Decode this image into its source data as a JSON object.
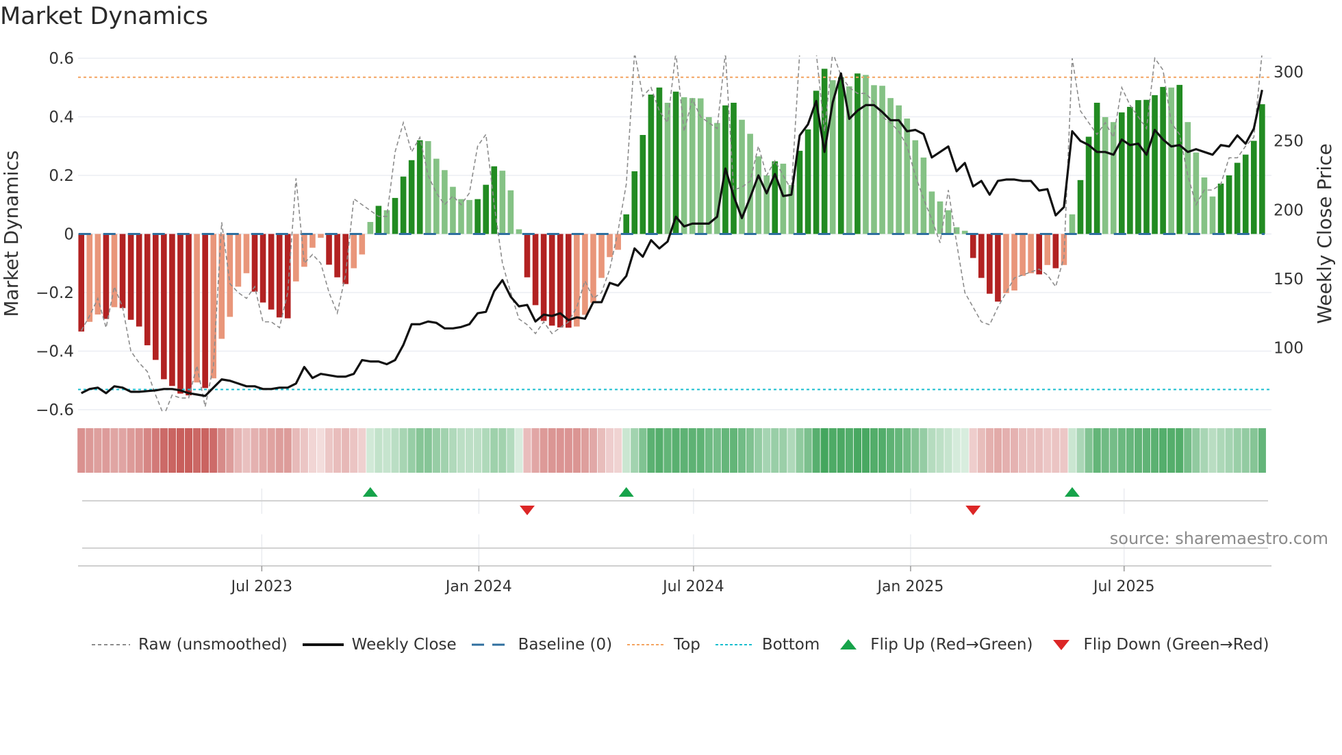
{
  "title": "Market Dynamics",
  "source": "source: sharemaestro.com",
  "legend": [
    {
      "key": "raw",
      "label": "Raw (unsmoothed)"
    },
    {
      "key": "close",
      "label": "Weekly Close"
    },
    {
      "key": "baseline",
      "label": "Baseline (0)"
    },
    {
      "key": "top",
      "label": "Top"
    },
    {
      "key": "bottom",
      "label": "Bottom"
    },
    {
      "key": "flip_up",
      "label": "Flip Up (Red→Green)"
    },
    {
      "key": "flip_down",
      "label": "Flip Down (Green→Red)"
    }
  ],
  "colors": {
    "bar_up_strong": "#228b22",
    "bar_up_weak": "#85c285",
    "bar_down_strong": "#b22222",
    "bar_down_weak": "#e9967a",
    "strip_up": "#3aa155",
    "strip_down": "#c4524f",
    "raw": "#8c8c8c",
    "close": "#111111",
    "baseline": "#2f6f9f",
    "top": "#f4a460",
    "bottom": "#17becf",
    "flip_up": "#16a34a",
    "flip_down": "#dc2626",
    "grid": "#ebedf3"
  },
  "chart_data": {
    "type": "bar",
    "title": "Market Dynamics",
    "xlabel": "",
    "ylabel": "Market Dynamics",
    "ylabel_right": "Weekly Close Price",
    "ylim": [
      -0.6,
      0.6
    ],
    "ylim_right": [
      55,
      310
    ],
    "yticks": [
      0.6,
      0.4,
      0.2,
      0,
      -0.2,
      -0.4,
      -0.6
    ],
    "ytick_labels": [
      "0.6",
      "0.4",
      "0.2",
      "0",
      "−0.2",
      "−0.4",
      "−0.6"
    ],
    "yticks_right": [
      300,
      250,
      200,
      150,
      100
    ],
    "ytick_labels_right": [
      "300",
      "250",
      "200",
      "150",
      "100"
    ],
    "xticks": [
      "2023-07-01",
      "2024-01-01",
      "2024-07-01",
      "2025-01-01",
      "2025-07-01"
    ],
    "xtick_labels": [
      "Jul 2023",
      "Jan 2024",
      "Jul 2024",
      "Jan 2025",
      "Jul 2025"
    ],
    "start_date": "2023-01-29",
    "frequency": "weekly",
    "top_level": 0.535,
    "bottom_level": -0.531,
    "baseline": 0,
    "legend_position": "bottom",
    "series": [
      {
        "name": "Market Dynamics (smoothed)",
        "values": [
          -0.333,
          -0.3,
          -0.275,
          -0.29,
          -0.25,
          -0.253,
          -0.293,
          -0.316,
          -0.38,
          -0.43,
          -0.496,
          -0.519,
          -0.545,
          -0.551,
          -0.507,
          -0.526,
          -0.493,
          -0.358,
          -0.283,
          -0.18,
          -0.134,
          -0.197,
          -0.234,
          -0.258,
          -0.285,
          -0.288,
          -0.162,
          -0.112,
          -0.047,
          -0.013,
          -0.105,
          -0.148,
          -0.171,
          -0.117,
          -0.07,
          0.041,
          0.096,
          0.081,
          0.123,
          0.196,
          0.252,
          0.32,
          0.317,
          0.257,
          0.218,
          0.161,
          0.119,
          0.116,
          0.119,
          0.168,
          0.231,
          0.216,
          0.149,
          0.016,
          -0.148,
          -0.243,
          -0.297,
          -0.313,
          -0.319,
          -0.32,
          -0.316,
          -0.276,
          -0.235,
          -0.15,
          -0.079,
          -0.054,
          0.067,
          0.214,
          0.338,
          0.476,
          0.5,
          0.448,
          0.486,
          0.467,
          0.464,
          0.463,
          0.399,
          0.379,
          0.439,
          0.448,
          0.39,
          0.342,
          0.265,
          0.2,
          0.248,
          0.24,
          0.167,
          0.284,
          0.357,
          0.489,
          0.564,
          0.525,
          0.535,
          0.504,
          0.548,
          0.543,
          0.508,
          0.506,
          0.464,
          0.439,
          0.394,
          0.32,
          0.261,
          0.145,
          0.111,
          0.081,
          0.023,
          0.011,
          -0.082,
          -0.15,
          -0.204,
          -0.231,
          -0.202,
          -0.193,
          -0.143,
          -0.134,
          -0.138,
          -0.106,
          -0.117,
          -0.106,
          0.067,
          0.184,
          0.332,
          0.448,
          0.399,
          0.382,
          0.415,
          0.434,
          0.457,
          0.458,
          0.474,
          0.502,
          0.5,
          0.509,
          0.382,
          0.278,
          0.193,
          0.128,
          0.172,
          0.2,
          0.243,
          0.271,
          0.318,
          0.443
        ]
      },
      {
        "name": "Raw (unsmoothed)",
        "values": [
          -0.33,
          -0.28,
          -0.22,
          -0.32,
          -0.18,
          -0.25,
          -0.4,
          -0.44,
          -0.47,
          -0.55,
          -0.62,
          -0.55,
          -0.56,
          -0.56,
          -0.45,
          -0.59,
          -0.45,
          0.04,
          -0.17,
          -0.2,
          -0.22,
          -0.18,
          -0.3,
          -0.3,
          -0.32,
          -0.2,
          0.19,
          -0.1,
          -0.07,
          -0.1,
          -0.2,
          -0.27,
          -0.14,
          0.12,
          0.1,
          0.08,
          0.06,
          0.06,
          0.28,
          0.38,
          0.28,
          0.33,
          0.2,
          0.14,
          0.1,
          0.13,
          0.1,
          0.14,
          0.3,
          0.34,
          0.1,
          -0.1,
          -0.2,
          -0.29,
          -0.31,
          -0.34,
          -0.3,
          -0.34,
          -0.32,
          -0.3,
          -0.25,
          -0.16,
          -0.22,
          -0.2,
          -0.12,
          0.01,
          0.17,
          0.62,
          0.47,
          0.5,
          0.42,
          0.38,
          0.62,
          0.35,
          0.46,
          0.4,
          0.38,
          0.36,
          0.62,
          0.15,
          0.16,
          0.18,
          0.3,
          0.2,
          0.25,
          0.2,
          0.15,
          0.62,
          0.62,
          0.62,
          0.35,
          0.62,
          0.54,
          0.5,
          0.48,
          0.48,
          0.45,
          0.4,
          0.38,
          0.35,
          0.3,
          0.2,
          0.12,
          0.05,
          -0.03,
          0.15,
          -0.03,
          -0.2,
          -0.25,
          -0.3,
          -0.31,
          -0.25,
          -0.2,
          -0.15,
          -0.14,
          -0.13,
          -0.12,
          -0.14,
          -0.18,
          -0.08,
          0.6,
          0.42,
          0.38,
          0.34,
          0.38,
          0.33,
          0.5,
          0.44,
          0.4,
          0.36,
          0.6,
          0.56,
          0.38,
          0.34,
          0.2,
          0.1,
          0.15,
          0.15,
          0.17,
          0.26,
          0.26,
          0.3,
          0.33,
          0.62
        ]
      },
      {
        "name": "Weekly Close",
        "axis": "right",
        "values": [
          67,
          70,
          71,
          67,
          72,
          71,
          68,
          68,
          68.5,
          69,
          70,
          70,
          69,
          67,
          66,
          65,
          71,
          77,
          76,
          74,
          72,
          72,
          70,
          70,
          71,
          71,
          74,
          86,
          78,
          81,
          80,
          79,
          79,
          81,
          91,
          90,
          90,
          88,
          91,
          102,
          117,
          117,
          119,
          118,
          114,
          114,
          115,
          117,
          125,
          126,
          141,
          149,
          137,
          130,
          131,
          119,
          124,
          123,
          125,
          120,
          122,
          121,
          133,
          133,
          147,
          145,
          152,
          172,
          166,
          178,
          172,
          177,
          195,
          188,
          190,
          190,
          190,
          195,
          230,
          210,
          194,
          209,
          225,
          212,
          226,
          210,
          211,
          254,
          262,
          279,
          242,
          278,
          299,
          266,
          272,
          276,
          276,
          271,
          265,
          265,
          257,
          258,
          255,
          238,
          242,
          246,
          228,
          234,
          217,
          221,
          211,
          221,
          222,
          222,
          221,
          221,
          214,
          215,
          196,
          202,
          257,
          250,
          247,
          242,
          242,
          240,
          251,
          247,
          248,
          240,
          258,
          251,
          246,
          247,
          242,
          244,
          242,
          240,
          247,
          246,
          254,
          248,
          259,
          287
        ]
      }
    ],
    "flips": [
      {
        "type": "up",
        "index": 35
      },
      {
        "type": "down",
        "index": 54
      },
      {
        "type": "up",
        "index": 66
      },
      {
        "type": "down",
        "index": 108
      },
      {
        "type": "up",
        "index": 120
      }
    ]
  }
}
